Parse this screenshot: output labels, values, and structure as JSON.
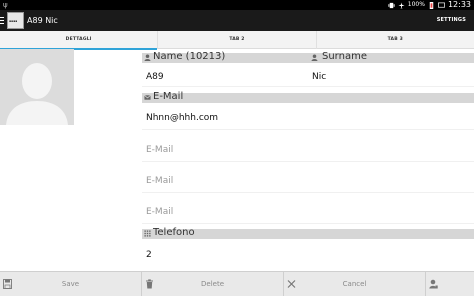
{
  "status_bar": {
    "battery_percent": "100%",
    "time": "12:33"
  },
  "action_bar": {
    "title": "A89 Nic",
    "settings_label": "SETTINGS"
  },
  "tabs": [
    {
      "label": "DETTAGLI",
      "active": true
    },
    {
      "label": "TAB 2",
      "active": false
    },
    {
      "label": "TAB 3",
      "active": false
    }
  ],
  "form": {
    "name_header": "Name (10213)",
    "surname_header": "Surname",
    "name_value": "A89",
    "surname_value": "Nic",
    "email_header": "E-Mail",
    "email_value": "Nhnn@hhh.com",
    "email_placeholders": [
      "E-Mail",
      "E-Mail",
      "E-Mail"
    ],
    "phone_header": "Telefono",
    "phone_value": "2"
  },
  "bottom_bar": {
    "save_label": "Save",
    "delete_label": "Delete",
    "cancel_label": "Cancel"
  },
  "colors": {
    "tab_indicator": "#2fa3d8",
    "action_bar": "#1a1a1a",
    "section_header": "#d6d6d6"
  },
  "icons": {
    "save": "floppy-disk-icon",
    "delete": "trash-icon",
    "cancel": "close-icon",
    "contact": "person-icon",
    "email": "envelope-icon",
    "phone": "dialpad-icon"
  }
}
